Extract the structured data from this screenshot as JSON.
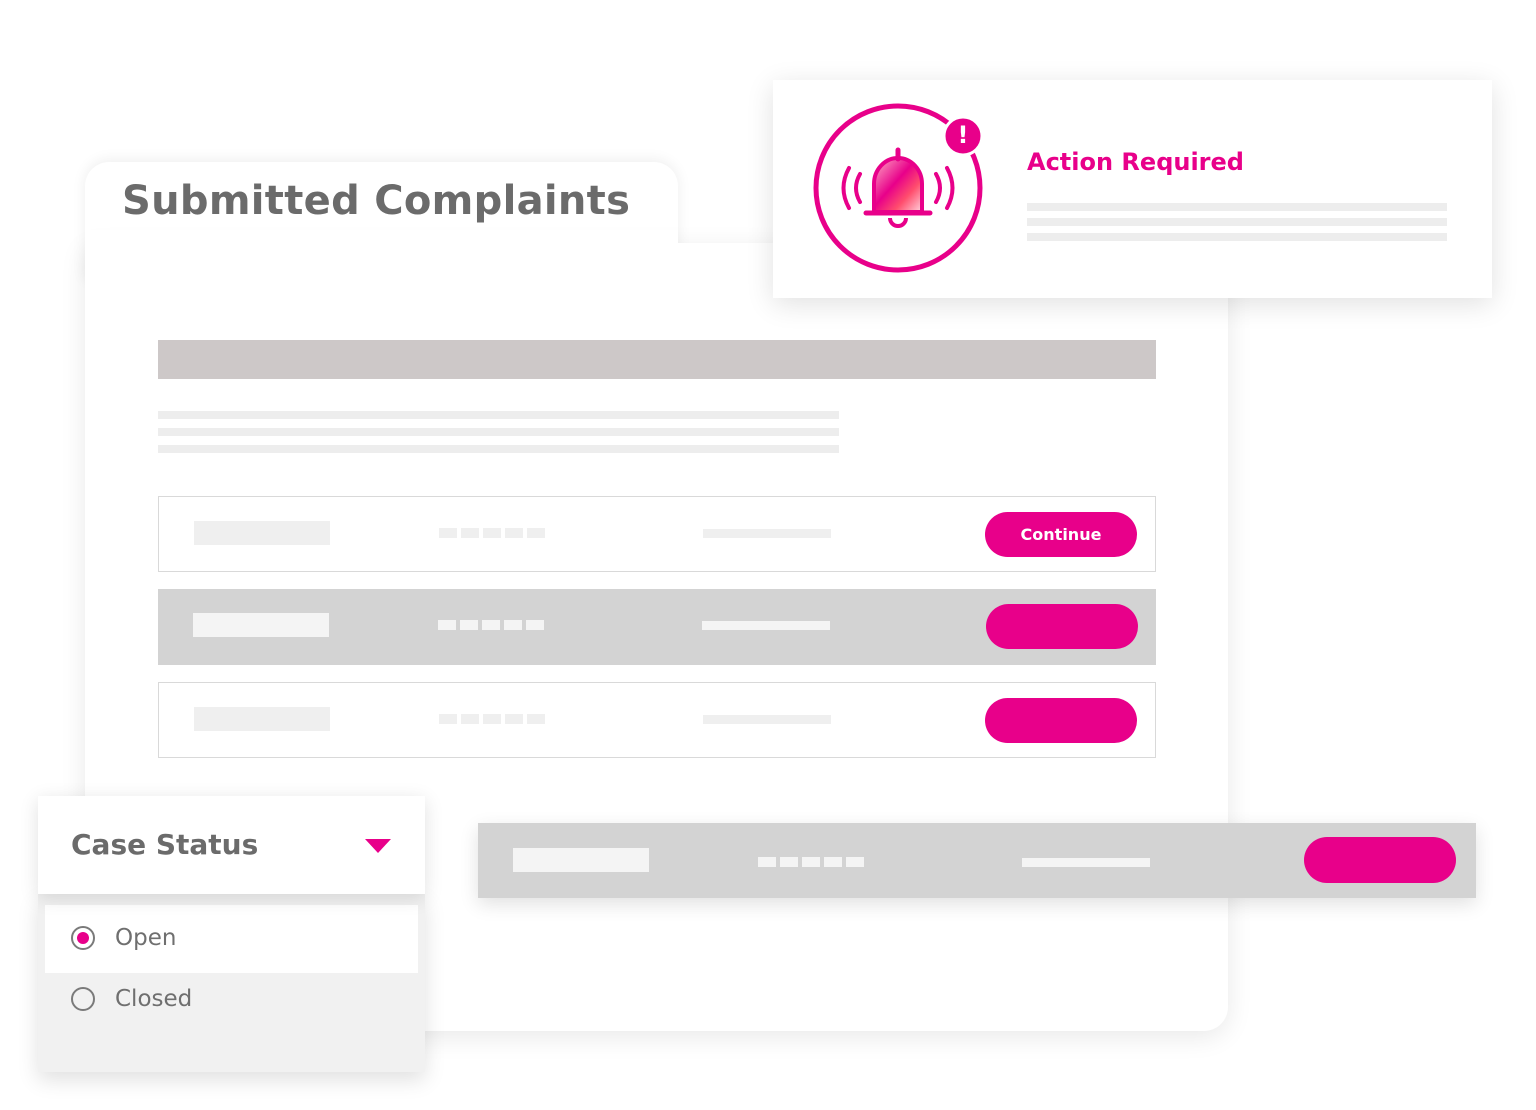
{
  "panel": {
    "title": "Submitted Complaints"
  },
  "table": {
    "rows": [
      {
        "style": "light",
        "button_label": "Continue"
      },
      {
        "style": "dark",
        "button_label": ""
      },
      {
        "style": "light",
        "button_label": ""
      }
    ],
    "floating_row": {
      "button_label": ""
    }
  },
  "notification": {
    "title": "Action Required",
    "icon": "alarm-bell-icon",
    "badge_icon": "exclamation-icon",
    "badge_text": "!"
  },
  "case_status": {
    "label": "Case Status",
    "caret_icon": "caret-down-icon",
    "options": [
      {
        "label": "Open",
        "selected": true
      },
      {
        "label": "Closed",
        "selected": false
      }
    ]
  },
  "colors": {
    "accent": "#e8008a",
    "heading_gray": "#6b6b6b",
    "header_bar": "#cdc8c8",
    "row_dark": "#d3d3d3",
    "placeholder": "#efefef"
  }
}
